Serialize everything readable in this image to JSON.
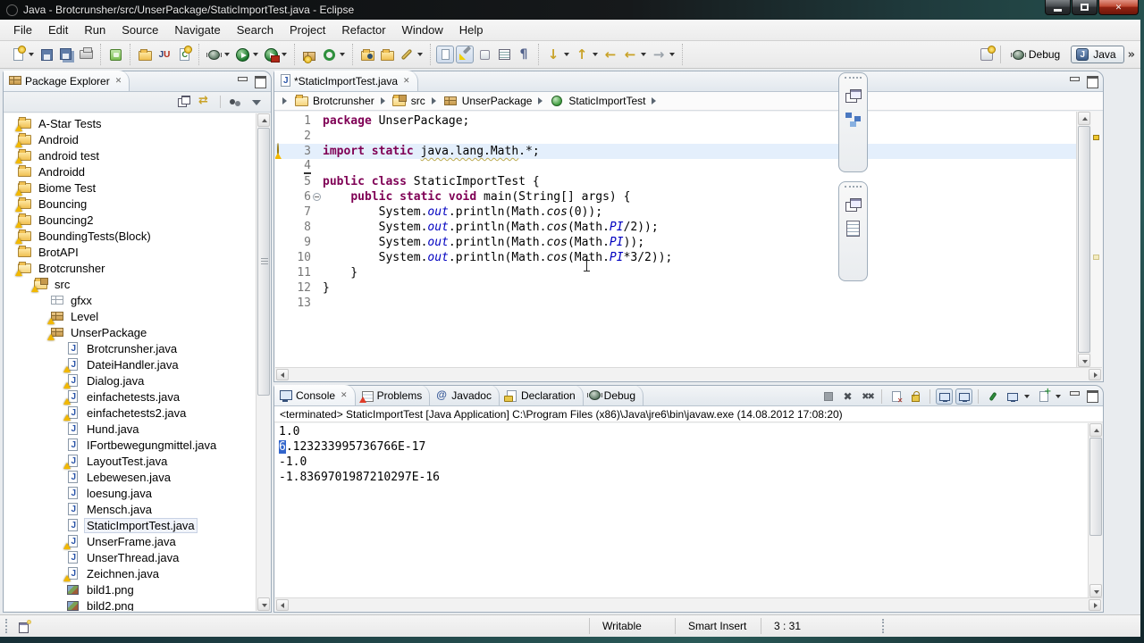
{
  "window": {
    "title": "Java - Brotcrunsher/src/UnserPackage/StaticImportTest.java - Eclipse"
  },
  "menu": {
    "items": [
      "File",
      "Edit",
      "Run",
      "Source",
      "Navigate",
      "Search",
      "Project",
      "Refactor",
      "Window",
      "Help"
    ]
  },
  "toolbar": {
    "overflow_chevron": "»",
    "groups": [
      {
        "icons": [
          {
            "name": "new-wizard",
            "dropdown": true
          },
          {
            "name": "save"
          },
          {
            "name": "save-all"
          },
          {
            "name": "print"
          }
        ]
      },
      {
        "icons": [
          {
            "name": "android-sdk"
          }
        ]
      },
      {
        "icons": [
          {
            "name": "new-java-project"
          },
          {
            "name": "new-junit-test"
          },
          {
            "name": "new-class"
          }
        ]
      },
      {
        "icons": [
          {
            "name": "debug",
            "dropdown": true
          },
          {
            "name": "run",
            "dropdown": true
          },
          {
            "name": "run-external",
            "dropdown": true
          }
        ]
      },
      {
        "icons": [
          {
            "name": "new-package"
          },
          {
            "name": "coverage",
            "dropdown": true
          }
        ]
      },
      {
        "icons": [
          {
            "name": "open-type"
          },
          {
            "name": "open-resource"
          },
          {
            "name": "annotate-pen",
            "dropdown": true
          }
        ]
      },
      {
        "icons": [
          {
            "name": "show-breadcrumb",
            "pressed": true
          },
          {
            "name": "mark-occurrences",
            "pressed": true
          },
          {
            "name": "block-selection"
          },
          {
            "name": "show-source"
          },
          {
            "name": "show-whitespace",
            "glyph": "¶"
          }
        ]
      },
      {
        "icons": [
          {
            "name": "next-annotation",
            "glyph": "↓",
            "gold": true,
            "dropdown": true
          },
          {
            "name": "previous-annotation",
            "glyph": "↑",
            "gold": true,
            "dropdown": true
          },
          {
            "name": "last-edit-location",
            "glyph": "←",
            "gold": true
          },
          {
            "name": "back",
            "glyph": "←",
            "gold": true,
            "dropdown": true
          },
          {
            "name": "forward",
            "glyph": "→",
            "dropdown": true
          }
        ]
      }
    ],
    "perspectives": {
      "items": [
        {
          "label": "Debug",
          "icon": "debug"
        },
        {
          "label": "Java",
          "icon": "java",
          "active": true
        }
      ]
    }
  },
  "package_explorer": {
    "title": "Package Explorer",
    "toolbar": [
      "collapse-all",
      "link-with-editor",
      "focus",
      "view-menu"
    ],
    "tree": [
      {
        "label": "A-Star Tests",
        "depth": 0,
        "icon": "project",
        "warn": true
      },
      {
        "label": "Android",
        "depth": 0,
        "icon": "project",
        "warn": true
      },
      {
        "label": "android test",
        "depth": 0,
        "icon": "project",
        "warn": true
      },
      {
        "label": "Androidd",
        "depth": 0,
        "icon": "project",
        "warn": false
      },
      {
        "label": "Biome Test",
        "depth": 0,
        "icon": "project",
        "warn": true
      },
      {
        "label": "Bouncing",
        "depth": 0,
        "icon": "project",
        "warn": true
      },
      {
        "label": "Bouncing2",
        "depth": 0,
        "icon": "project",
        "warn": true
      },
      {
        "label": "BoundingTests(Block)",
        "depth": 0,
        "icon": "project",
        "warn": true
      },
      {
        "label": "BrotAPI",
        "depth": 0,
        "icon": "project",
        "warn": false
      },
      {
        "label": "Brotcrunsher",
        "depth": 0,
        "icon": "project-open",
        "warn": true
      },
      {
        "label": "src",
        "depth": 1,
        "icon": "src",
        "warn": true
      },
      {
        "label": "gfxx",
        "depth": 2,
        "icon": "pkg-empty",
        "warn": false
      },
      {
        "label": "Level",
        "depth": 2,
        "icon": "pkg",
        "warn": true
      },
      {
        "label": "UnserPackage",
        "depth": 2,
        "icon": "pkg",
        "warn": true
      },
      {
        "label": "Brotcrunsher.java",
        "depth": 3,
        "icon": "jfile",
        "warn": false
      },
      {
        "label": "DateiHandler.java",
        "depth": 3,
        "icon": "jfile",
        "warn": true
      },
      {
        "label": "Dialog.java",
        "depth": 3,
        "icon": "jfile",
        "warn": true
      },
      {
        "label": "einfachetests.java",
        "depth": 3,
        "icon": "jfile",
        "warn": true
      },
      {
        "label": "einfachetests2.java",
        "depth": 3,
        "icon": "jfile",
        "warn": true
      },
      {
        "label": "Hund.java",
        "depth": 3,
        "icon": "jfile",
        "warn": false
      },
      {
        "label": "IFortbewegungmittel.java",
        "depth": 3,
        "icon": "jfile",
        "warn": false
      },
      {
        "label": "LayoutTest.java",
        "depth": 3,
        "icon": "jfile",
        "warn": true
      },
      {
        "label": "Lebewesen.java",
        "depth": 3,
        "icon": "jfile",
        "warn": false
      },
      {
        "label": "loesung.java",
        "depth": 3,
        "icon": "jfile",
        "warn": false
      },
      {
        "label": "Mensch.java",
        "depth": 3,
        "icon": "jfile",
        "warn": false
      },
      {
        "label": "StaticImportTest.java",
        "depth": 3,
        "icon": "jfile",
        "warn": false,
        "selected": true
      },
      {
        "label": "UnserFrame.java",
        "depth": 3,
        "icon": "jfile",
        "warn": true
      },
      {
        "label": "UnserThread.java",
        "depth": 3,
        "icon": "jfile",
        "warn": false
      },
      {
        "label": "Zeichnen.java",
        "depth": 3,
        "icon": "jfile",
        "warn": true
      },
      {
        "label": "bild1.png",
        "depth": 3,
        "icon": "img",
        "warn": false
      },
      {
        "label": "bild2.png",
        "depth": 3,
        "icon": "img",
        "warn": false
      }
    ]
  },
  "editor": {
    "tab_label": "*StaticImportTest.java",
    "breadcrumb": [
      {
        "label": "Brotcrunsher",
        "icon": "project"
      },
      {
        "label": "src",
        "icon": "src"
      },
      {
        "label": "UnserPackage",
        "icon": "pkg"
      },
      {
        "label": "StaticImportTest",
        "icon": "class"
      }
    ],
    "lines": [
      {
        "n": 1,
        "tokens": [
          {
            "t": "package",
            "c": "kw"
          },
          {
            "t": " UnserPackage;",
            "c": "pl"
          }
        ]
      },
      {
        "n": 2,
        "tokens": []
      },
      {
        "n": 3,
        "hl": true,
        "warn": true,
        "tokens": [
          {
            "t": "import",
            "c": "kw"
          },
          {
            "t": " ",
            "c": "pl"
          },
          {
            "t": "static",
            "c": "kw"
          },
          {
            "t": " ",
            "c": "pl"
          },
          {
            "t": "java.lang.Math",
            "c": "wv"
          },
          {
            "t": ".*;",
            "c": "pl"
          }
        ]
      },
      {
        "n": 4,
        "range": true,
        "tokens": []
      },
      {
        "n": 5,
        "tokens": [
          {
            "t": "public",
            "c": "kw"
          },
          {
            "t": " ",
            "c": "pl"
          },
          {
            "t": "class",
            "c": "kw"
          },
          {
            "t": " StaticImportTest {",
            "c": "pl"
          }
        ]
      },
      {
        "n": 6,
        "fold": true,
        "tokens": [
          {
            "t": "    ",
            "c": "pl"
          },
          {
            "t": "public",
            "c": "kw"
          },
          {
            "t": " ",
            "c": "pl"
          },
          {
            "t": "static",
            "c": "kw"
          },
          {
            "t": " ",
            "c": "pl"
          },
          {
            "t": "void",
            "c": "kw"
          },
          {
            "t": " main(String[] args) {",
            "c": "pl"
          }
        ]
      },
      {
        "n": 7,
        "tokens": [
          {
            "t": "        System.",
            "c": "pl"
          },
          {
            "t": "out",
            "c": "sf"
          },
          {
            "t": ".println(Math.",
            "c": "pl"
          },
          {
            "t": "cos",
            "c": "sm"
          },
          {
            "t": "(0));",
            "c": "pl"
          }
        ]
      },
      {
        "n": 8,
        "tokens": [
          {
            "t": "        System.",
            "c": "pl"
          },
          {
            "t": "out",
            "c": "sf"
          },
          {
            "t": ".println(Math.",
            "c": "pl"
          },
          {
            "t": "cos",
            "c": "sm"
          },
          {
            "t": "(Math.",
            "c": "pl"
          },
          {
            "t": "PI",
            "c": "sf"
          },
          {
            "t": "/2));",
            "c": "pl"
          }
        ]
      },
      {
        "n": 9,
        "tokens": [
          {
            "t": "        System.",
            "c": "pl"
          },
          {
            "t": "out",
            "c": "sf"
          },
          {
            "t": ".println(Math.",
            "c": "pl"
          },
          {
            "t": "cos",
            "c": "sm"
          },
          {
            "t": "(Math.",
            "c": "pl"
          },
          {
            "t": "PI",
            "c": "sf"
          },
          {
            "t": "));",
            "c": "pl"
          }
        ]
      },
      {
        "n": 10,
        "tokens": [
          {
            "t": "        System.",
            "c": "pl"
          },
          {
            "t": "out",
            "c": "sf"
          },
          {
            "t": ".println(Math.",
            "c": "pl"
          },
          {
            "t": "cos",
            "c": "sm"
          },
          {
            "t": "(Math.",
            "c": "pl"
          },
          {
            "t": "PI",
            "c": "sf"
          },
          {
            "t": "*3/2));",
            "c": "pl"
          }
        ]
      },
      {
        "n": 11,
        "tokens": [
          {
            "t": "    }",
            "c": "pl"
          }
        ]
      },
      {
        "n": 12,
        "tokens": [
          {
            "t": "}",
            "c": "pl"
          }
        ]
      },
      {
        "n": 13,
        "tokens": []
      }
    ]
  },
  "console": {
    "tabs": [
      {
        "label": "Console",
        "icon": "console",
        "active": true,
        "closable": true
      },
      {
        "label": "Problems",
        "icon": "problems"
      },
      {
        "label": "Javadoc",
        "icon": "javadoc"
      },
      {
        "label": "Declaration",
        "icon": "declaration"
      },
      {
        "label": "Debug",
        "icon": "debug"
      }
    ],
    "toolbar_groups": [
      [
        {
          "name": "terminate"
        },
        {
          "name": "remove-launch"
        },
        {
          "name": "remove-all-terminated"
        }
      ],
      [
        {
          "name": "clear-console"
        },
        {
          "name": "scroll-lock"
        }
      ],
      [
        {
          "name": "show-stdout",
          "pressed": true
        },
        {
          "name": "show-stderr",
          "pressed": true
        }
      ],
      [
        {
          "name": "pin-console"
        },
        {
          "name": "display-selected-console",
          "dropdown": true
        },
        {
          "name": "open-console",
          "dropdown": true
        }
      ]
    ],
    "status": "<terminated> StaticImportTest [Java Application] C:\\Program Files (x86)\\Java\\jre6\\bin\\javaw.exe (14.08.2012 17:08:20)",
    "output": [
      {
        "text": "1.0"
      },
      {
        "text": "6.123233995736766E-17",
        "sel_prefix": 1
      },
      {
        "text": "-1.0"
      },
      {
        "text": "-1.8369701987210297E-16"
      }
    ]
  },
  "statusbar": {
    "writable": "Writable",
    "insert_mode": "Smart Insert",
    "position": "3 : 31"
  },
  "colors": {
    "current_line": "#e4effc",
    "selection": "#3265cc",
    "keyword": "#7f0055",
    "static_member": "#0000c0",
    "warn_overlay": "#f2b800"
  }
}
